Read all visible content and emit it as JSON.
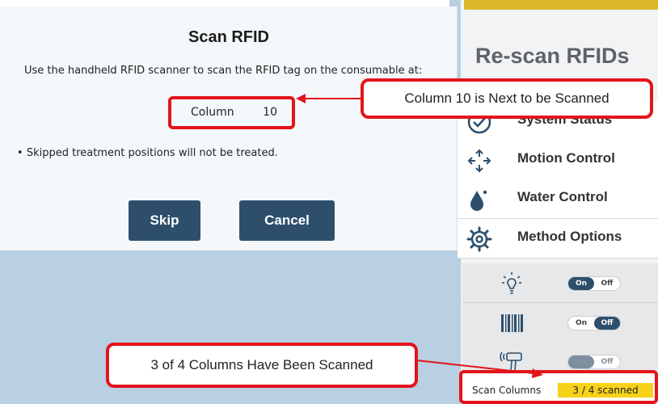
{
  "dialog": {
    "title": "Scan RFID",
    "instruction": "Use the handheld RFID scanner to scan the RFID tag on the consumable at:",
    "column_label": "Column",
    "column_value": "10",
    "bullet": "Skipped treatment positions will not be treated.",
    "skip_label": "Skip",
    "cancel_label": "Cancel"
  },
  "panel": {
    "title": "Re-scan RFIDs",
    "menu": [
      {
        "label": "System Status",
        "icon": "status-icon"
      },
      {
        "label": "Motion Control",
        "icon": "move-arrows-icon"
      },
      {
        "label": "Water Control",
        "icon": "water-drop-icon"
      },
      {
        "label": "Method Options",
        "icon": "gear-icon"
      }
    ],
    "toggles": [
      {
        "icon": "light-bulb-icon",
        "on": "On",
        "off": "Off",
        "state": "on"
      },
      {
        "icon": "barcode-icon",
        "on": "On",
        "off": "Off",
        "state": "off"
      },
      {
        "icon": "rfid-scanner-icon",
        "on": "On",
        "off": "Off",
        "state": "on",
        "dimmed": true
      }
    ],
    "scan_label": "Scan Columns",
    "scan_progress": "3 / 4 scanned"
  },
  "callouts": {
    "top": "Column 10 is Next to be Scanned",
    "bottom": "3 of 4 Columns Have Been Scanned"
  },
  "colors": {
    "accent_red": "#e3141b",
    "button_navy": "#2d4f6c",
    "progress_yellow": "#f7d21a",
    "header_gold": "#dcb628"
  }
}
